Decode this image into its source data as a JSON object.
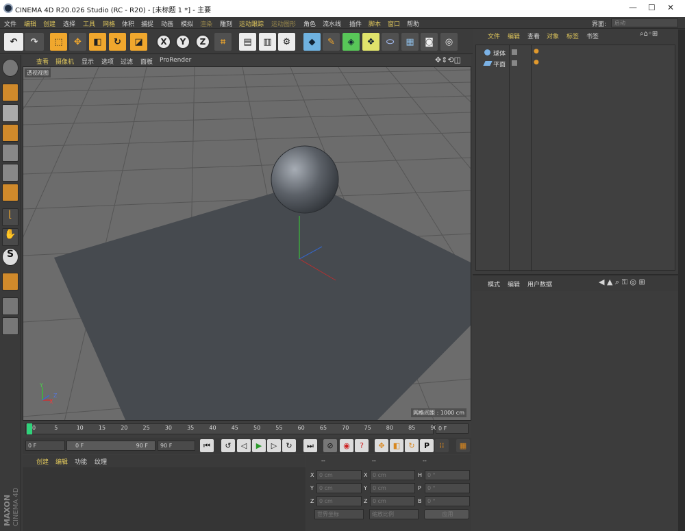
{
  "window": {
    "title": "CINEMA 4D R20.026 Studio (RC - R20) - [未标题 1 *] - 主要",
    "minimize": "—",
    "maximize": "☐",
    "close": "✕"
  },
  "menu": {
    "items": [
      "文件",
      "编辑",
      "创建",
      "选择",
      "工具",
      "网格",
      "体积",
      "捕捉",
      "动画",
      "模拟",
      "渲染",
      "雕刻",
      "运动跟踪",
      "运动图形",
      "角色",
      "流水线",
      "插件",
      "脚本",
      "窗口",
      "帮助"
    ],
    "layout_label": "界面:",
    "layout_value": "启动"
  },
  "toolbar": {
    "undo": "↶",
    "redo": "↷",
    "x": "X",
    "y": "Y",
    "z": "Z"
  },
  "viewport": {
    "menu": [
      "查看",
      "摄像机",
      "显示",
      "选项",
      "过滤",
      "面板",
      "ProRender"
    ],
    "label": "透视视图",
    "grid_spacing": "网格间距 : 1000 cm",
    "axis": {
      "x": "X",
      "y": "Y",
      "z": "Z"
    }
  },
  "timeline": {
    "ticks": [
      "0",
      "5",
      "10",
      "15",
      "20",
      "25",
      "30",
      "35",
      "40",
      "45",
      "50",
      "55",
      "60",
      "65",
      "70",
      "75",
      "80",
      "85",
      "90"
    ],
    "end_frame": "0 F"
  },
  "transport": {
    "start": "0 F",
    "range_start": "0 F",
    "range_end": "90 F",
    "end": "90 F"
  },
  "material": {
    "menu": [
      "创建",
      "编辑",
      "功能",
      "纹理"
    ]
  },
  "coordinates": {
    "header_a": "--",
    "header_b": "--",
    "header_c": "--",
    "rows": [
      {
        "a": "X",
        "av": "0 cm",
        "b": "X",
        "bv": "0 cm",
        "c": "H",
        "cv": "0 °"
      },
      {
        "a": "Y",
        "av": "0 cm",
        "b": "Y",
        "bv": "0 cm",
        "c": "P",
        "cv": "0 °"
      },
      {
        "a": "Z",
        "av": "0 cm",
        "b": "Z",
        "bv": "0 cm",
        "c": "B",
        "cv": "0 °"
      }
    ],
    "world": "世界坐标",
    "scale": "缩放比例",
    "apply": "应用"
  },
  "objects": {
    "menu": [
      "文件",
      "编辑",
      "查看",
      "对象",
      "标签",
      "书签"
    ],
    "items": [
      {
        "name": "球体"
      },
      {
        "name": "平面"
      }
    ]
  },
  "attributes": {
    "menu": [
      "模式",
      "编辑",
      "用户数据"
    ]
  },
  "brand": {
    "maxon": "MAXON",
    "product": "CINEMA 4D"
  },
  "colors": {
    "accent": "#dfc65c",
    "orange": "#f0a72d",
    "viewport": "#6d6d6d"
  }
}
